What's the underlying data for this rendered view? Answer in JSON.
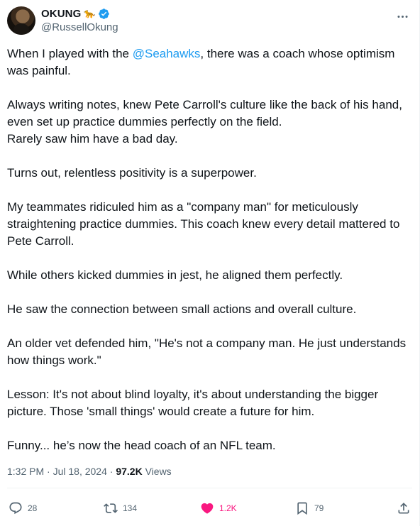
{
  "author": {
    "display_name": "OKUNG",
    "emoji": "🐆",
    "handle": "@RussellOkung",
    "verified_color": "#1d9bf0"
  },
  "tweet": {
    "paragraphs": [
      {
        "lines": [
          {
            "pre": "When I played with the ",
            "mention": "@Seahawks",
            "post": ", there was a coach whose optimism was painful."
          }
        ]
      },
      {
        "text": "Always writing notes, knew Pete Carroll's culture like the back of his hand, even set up practice dummies perfectly on the field."
      },
      {
        "text": "Rarely saw him have a bad day."
      },
      {
        "text": "Turns out, relentless positivity is a superpower."
      },
      {
        "text": "My teammates ridiculed him as a \"company man\" for meticulously straightening practice dummies. This coach knew every detail mattered to Pete Carroll."
      },
      {
        "text": "While others kicked dummies in jest, he aligned them perfectly."
      },
      {
        "text": "He saw the connection between small actions and overall culture."
      },
      {
        "text": "An older vet defended him, \"He's not a company man. He just understands how things work.\""
      },
      {
        "text": "Lesson: It's not about blind loyalty, it's about understanding the bigger picture. Those 'small things' would create a future for him."
      },
      {
        "text": "Funny... he’s now the head coach of an NFL team."
      }
    ],
    "intro_pre": "When I played with the ",
    "intro_mention": "@Seahawks",
    "intro_post": ", there was a coach whose optimism was painful.",
    "p2": "Always writing notes, knew Pete Carroll's culture like the back of his hand, even set up practice dummies perfectly on the field.",
    "p3": "Rarely saw him have a bad day.",
    "p4": "Turns out, relentless positivity is a superpower.",
    "p5": "My teammates ridiculed him as a \"company man\" for meticulously straightening practice dummies. This coach knew every detail mattered to Pete Carroll.",
    "p6": "While others kicked dummies in jest, he aligned them perfectly.",
    "p7": "He saw the connection between small actions and overall culture.",
    "p8": "An older vet defended him, \"He's not a company man. He just understands how things work.\"",
    "p9": "Lesson: It's not about blind loyalty, it's about understanding the bigger picture. Those 'small things' would create a future for him.",
    "p10": "Funny... he’s now the head coach of an NFL team."
  },
  "meta": {
    "time": "1:32 PM",
    "separator": " · ",
    "date": "Jul 18, 2024",
    "views_count": "97.2K",
    "views_label": " Views"
  },
  "actions": {
    "replies": "28",
    "reposts": "134",
    "likes": "1.2K",
    "bookmarks": "79",
    "like_color": "#f91880"
  },
  "icons": [
    "verified-badge-icon",
    "more-icon",
    "reply-icon",
    "repost-icon",
    "like-icon",
    "bookmark-icon",
    "share-icon"
  ]
}
